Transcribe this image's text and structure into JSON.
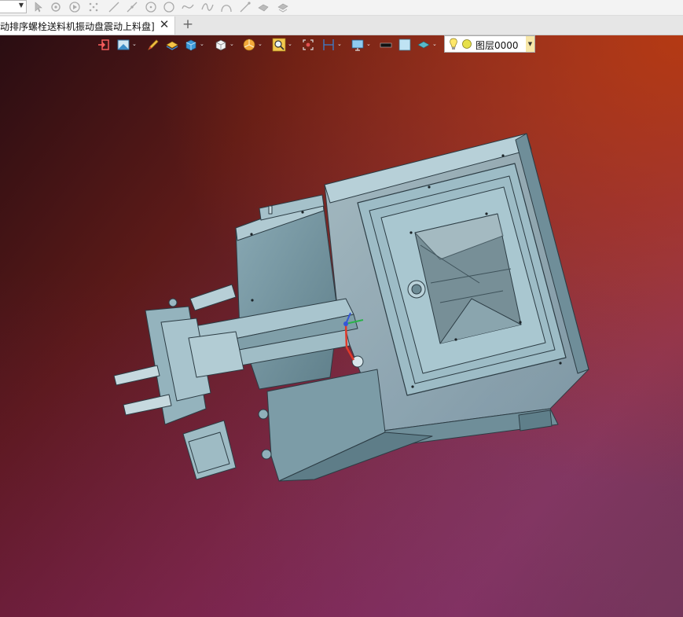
{
  "window": {
    "document_title": "动排序螺栓送料机振动盘震动上料盘]",
    "close_glyph": "✕",
    "add_tab_glyph": "+"
  },
  "sketch_toolbar": {
    "icons": [
      "select-arrow-icon",
      "point-icon",
      "play-icon",
      "dot-grid-icon",
      "line-icon",
      "line2-icon",
      "circle-center-icon",
      "circle-icon",
      "spline-icon",
      "wave-icon",
      "arc-icon",
      "polyline-icon",
      "shape-icon",
      "shape2-icon"
    ]
  },
  "view_toolbar": {
    "icons": [
      "exit-icon",
      "view-display-icon",
      "pencil-icon",
      "layer-stack-icon",
      "cube-blue-icon",
      "cube-white-icon",
      "pie-icon",
      "zoom-icon",
      "fit-icon",
      "dimension-icon",
      "monitor-icon",
      "black-line-icon",
      "square-icon",
      "layer-icon"
    ]
  },
  "layer": {
    "name": "图层0000"
  },
  "colors": {
    "model": "#8fb3bf",
    "model_edge": "#2c3c44",
    "layer_dropdown": "#f7e7a8"
  }
}
